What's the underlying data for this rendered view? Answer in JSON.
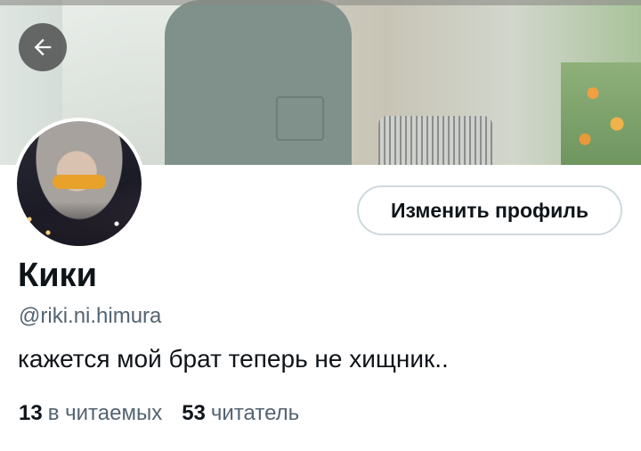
{
  "header": {
    "back_icon": "arrow-left-icon"
  },
  "profile": {
    "edit_button_label": "Изменить профиль",
    "display_name": "Кики",
    "handle": "@riki.ni.himura",
    "bio": "кажется мой брат теперь не хищник..",
    "following_count": "13",
    "following_label": "в читаемых",
    "followers_count": "53",
    "followers_label": "читатель"
  },
  "colors": {
    "text_primary": "#0f1419",
    "text_secondary": "#536471",
    "button_border": "#cfd9de"
  }
}
